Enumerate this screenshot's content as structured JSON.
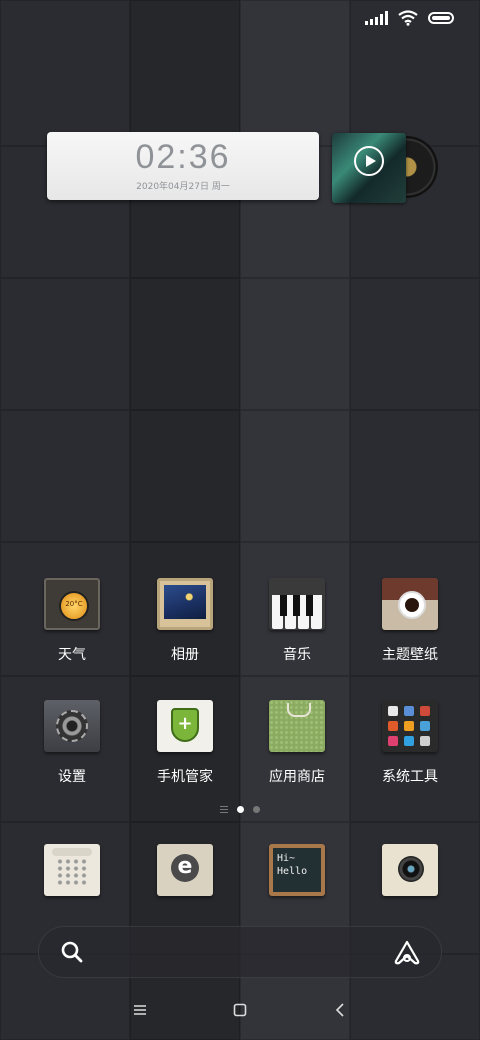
{
  "wallpaper": {
    "colors": [
      "#2b2c31",
      "#33343a",
      "#26272b"
    ]
  },
  "status_bar": {
    "icons": [
      "signal-icon",
      "wifi-icon",
      "battery-icon"
    ]
  },
  "clock_widget": {
    "time": "02:36",
    "date": "2020年04月27日 周一"
  },
  "music_widget": {
    "icons": [
      "play-icon",
      "vinyl-disc-icon"
    ]
  },
  "apps": [
    {
      "label": "天气",
      "icon": "weather-icon",
      "badge": "20°C"
    },
    {
      "label": "相册",
      "icon": "gallery-icon"
    },
    {
      "label": "音乐",
      "icon": "piano-icon"
    },
    {
      "label": "主题壁纸",
      "icon": "coffee-cup-icon"
    },
    {
      "label": "设置",
      "icon": "gear-icon"
    },
    {
      "label": "手机管家",
      "icon": "shield-icon"
    },
    {
      "label": "应用商店",
      "icon": "shopping-bag-icon"
    },
    {
      "label": "系统工具",
      "icon": "tools-folder-icon"
    }
  ],
  "dock": [
    {
      "icon": "phone-icon"
    },
    {
      "icon": "browser-icon",
      "glyph": "e"
    },
    {
      "icon": "notes-icon",
      "text_line1": "Hi~",
      "text_line2": "Hello"
    },
    {
      "icon": "camera-icon"
    }
  ],
  "pager": {
    "total": 2,
    "active": 1
  },
  "search_bar": {
    "icons": [
      "search-icon",
      "assistant-icon"
    ]
  },
  "nav_bar": {
    "icons": [
      "menu-icon",
      "home-icon",
      "back-icon"
    ]
  }
}
